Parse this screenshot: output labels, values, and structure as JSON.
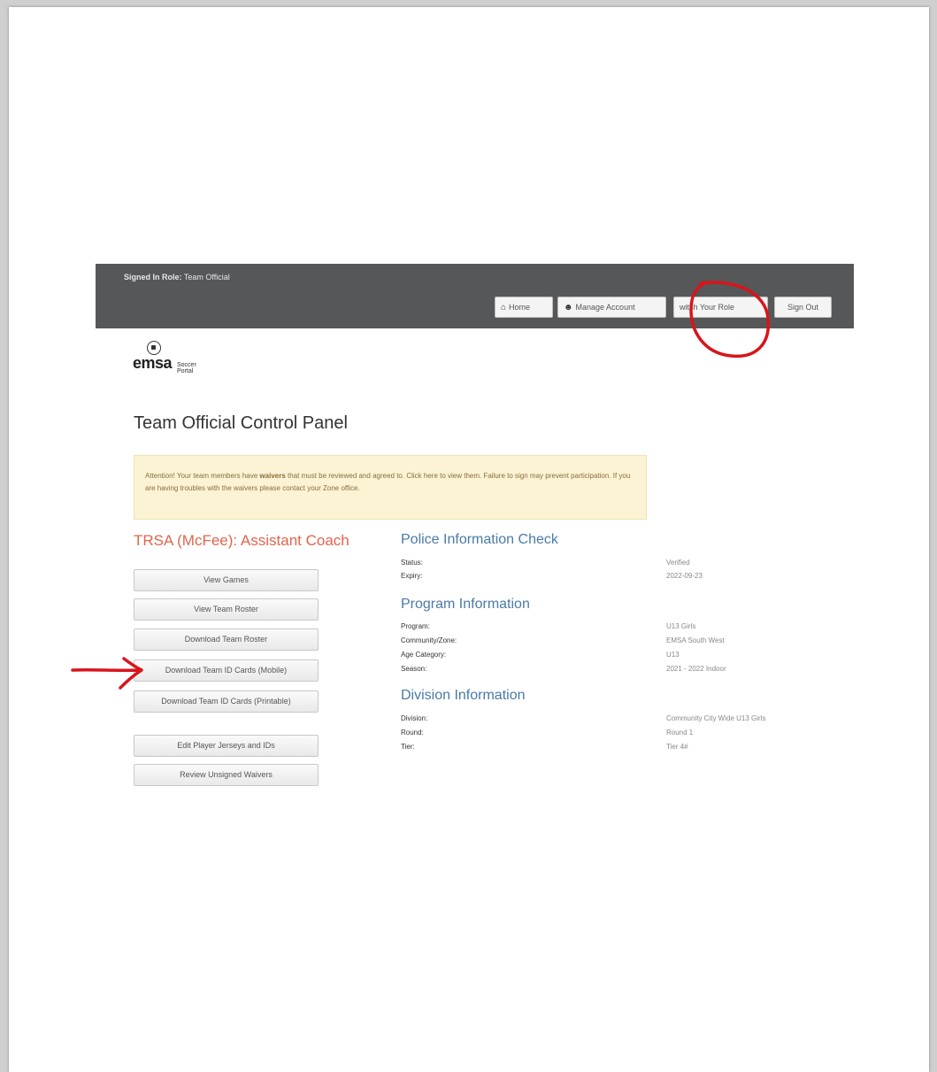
{
  "header": {
    "signed_in_label": "Signed In Role:",
    "signed_in_role": "Team Official",
    "nav": {
      "home": "Home",
      "manage_account": "Manage Account",
      "switch_role": "witch Your Role",
      "sign_out": "Sign Out"
    },
    "icons": {
      "home": "home-icon",
      "user": "user-icon"
    }
  },
  "logo": {
    "main": "emsa",
    "sub_line1": "Soccer",
    "sub_line2": "Portal"
  },
  "page_title": "Team Official Control Panel",
  "alert": {
    "text_before": "Attention! Your team members have",
    "bold_word": "waivers",
    "text_after": "that must be reviewed and agreed to. Click here to view them. Failure to sign may prevent participation. If you are having troubles with the waivers please contact your Zone office."
  },
  "role_title": "TRSA (McFee): Assistant Coach",
  "sidebar": {
    "buttons": [
      "View Games",
      "View Team Roster",
      "Download Team Roster",
      "Download Team ID Cards (Mobile)",
      "Download Team ID Cards (Printable)",
      "Edit Player Jerseys and IDs",
      "Review Unsigned Waivers"
    ]
  },
  "police_check": {
    "title": "Police Information Check",
    "rows": [
      {
        "label": "Status:",
        "value": "Verified"
      },
      {
        "label": "Expiry:",
        "value": "2022-09-23"
      }
    ]
  },
  "program_info": {
    "title": "Program Information",
    "rows": [
      {
        "label": "Program:",
        "value": "U13 Girls"
      },
      {
        "label": "Community/Zone:",
        "value": "EMSA South West"
      },
      {
        "label": "Age Category:",
        "value": "U13"
      },
      {
        "label": "Season:",
        "value": "2021 - 2022 Indoor"
      }
    ]
  },
  "division_info": {
    "title": "Division Information",
    "rows": [
      {
        "label": "Division:",
        "value": "Community City Wide U13 Girls"
      },
      {
        "label": "Round:",
        "value": "Round 1"
      },
      {
        "label": "Tier:",
        "value": "Tier 4#"
      }
    ]
  },
  "colors": {
    "topbar": "#555758",
    "role_title": "#e2644b",
    "section_title": "#4a7aa8",
    "alert_bg": "#fbf3d4",
    "annotation_red": "#d8141c"
  }
}
